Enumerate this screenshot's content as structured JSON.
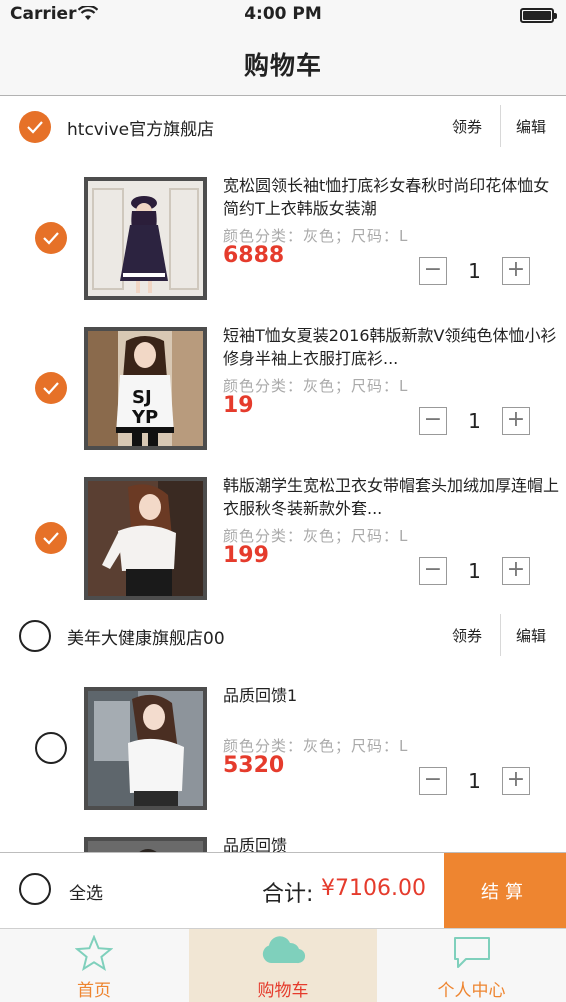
{
  "status_bar": {
    "carrier": "Carrier",
    "time": "4:00 PM"
  },
  "nav": {
    "title": "购物车"
  },
  "shops": [
    {
      "name": "htcvive官方旗舰店",
      "coupon_label": "领券",
      "edit_label": "编辑",
      "checked": true
    },
    {
      "name": "美年大健康旗舰店00",
      "coupon_label": "领券",
      "edit_label": "编辑",
      "checked": false
    }
  ],
  "items": [
    {
      "title": "宽松圆领长袖t恤打底衫女春秋时尚印花体恤女简约T上衣韩版女装潮",
      "spec": "颜色分类：灰色；尺码：L",
      "price": "6888",
      "qty": "1",
      "checked": true
    },
    {
      "title": "短袖T恤女夏装2016韩版新款V领纯色体恤小衫修身半袖上衣服打底衫...",
      "spec": "颜色分类：灰色；尺码：L",
      "price": "19",
      "qty": "1",
      "checked": true
    },
    {
      "title": "韩版潮学生宽松卫衣女带帽套头加绒加厚连帽上衣服秋冬装新款外套...",
      "spec": "颜色分类：灰色；尺码：L",
      "price": "199",
      "qty": "1",
      "checked": true
    },
    {
      "title": "品质回馈1",
      "spec": "颜色分类：灰色；尺码：L",
      "price": "5320",
      "qty": "1",
      "checked": false
    },
    {
      "title": "品质回馈",
      "spec": "",
      "price": "",
      "qty": "",
      "checked": false
    }
  ],
  "stepper": {
    "minus": "−",
    "plus": "+"
  },
  "summary": {
    "select_all_label": "全选",
    "total_label": "合计:",
    "total_value": "¥7106.00",
    "checkout_label": "结算"
  },
  "tabs": [
    {
      "label": "首页",
      "icon": "star-icon"
    },
    {
      "label": "购物车",
      "icon": "cloud-icon"
    },
    {
      "label": "个人中心",
      "icon": "chat-bubble-icon"
    }
  ],
  "colors": {
    "accent": "#e67128",
    "price": "#e53b2c",
    "checkout": "#ee8530",
    "tab_icon": "#7fd0bc"
  }
}
